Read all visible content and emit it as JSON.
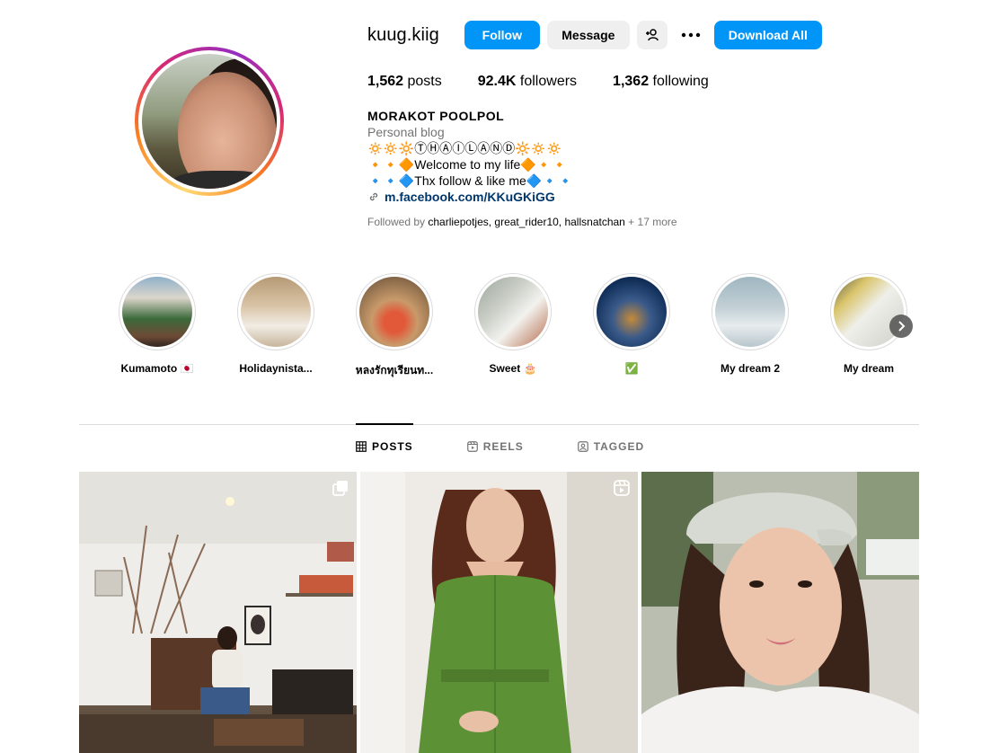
{
  "profile": {
    "username": "kuug.kiig",
    "buttons": {
      "follow": "Follow",
      "message": "Message",
      "download_all": "Download All"
    },
    "stats": {
      "posts_count": "1,562",
      "posts_label": "posts",
      "followers_count": "92.4K",
      "followers_label": "followers",
      "following_count": "1,362",
      "following_label": "following"
    },
    "bio": {
      "name": "MORAKOT POOLPOL",
      "category": "Personal blog",
      "line1": "🔅🔅🔆ⓉⒽⒶⒾⓁⒶⓃⒹ🔆🔅🔅",
      "line2": "🔸🔸🔶Welcome to my life🔶🔸🔸",
      "line3": "🔹🔹🔷Thx follow & like me🔷🔹🔹",
      "link": "m.facebook.com/KKuGKiGG"
    },
    "followed_by": {
      "prefix": "Followed by ",
      "names": "charliepotjes, great_rider10, hallsnatchan",
      "more": " + 17 more"
    }
  },
  "highlights": [
    {
      "label": "Kumamoto 🇯🇵"
    },
    {
      "label": "Holidaynista..."
    },
    {
      "label": "หลงรักทุเรียนท..."
    },
    {
      "label": "Sweet 🎂"
    },
    {
      "label": "✅"
    },
    {
      "label": "My dream 2"
    },
    {
      "label": "My dream"
    }
  ],
  "tabs": [
    {
      "label": "POSTS",
      "active": true
    },
    {
      "label": "REELS",
      "active": false
    },
    {
      "label": "TAGGED",
      "active": false
    }
  ],
  "icons": {
    "add_user": "person-add-icon",
    "more": "more-horizontal-icon",
    "link": "link-icon",
    "next": "chevron-right-icon",
    "posts_tab": "grid-icon",
    "reels_tab": "reels-icon",
    "tagged_tab": "tagged-icon",
    "carousel": "carousel-icon",
    "reel": "reel-icon"
  },
  "colors": {
    "accent": "#0095f6",
    "secondary_button": "#efefef",
    "muted_text": "#737373",
    "link_text": "#00376b"
  }
}
